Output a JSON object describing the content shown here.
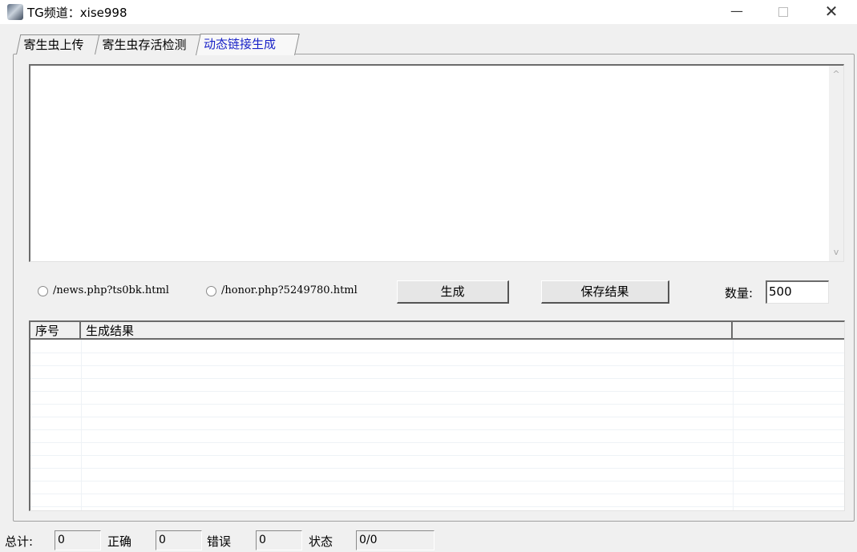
{
  "window": {
    "title": "TG频道：xise998",
    "minimize": "—",
    "close": "✕"
  },
  "tabs": [
    {
      "label": "寄生虫上传"
    },
    {
      "label": "寄生虫存活检测"
    },
    {
      "label": "动态链接生成"
    }
  ],
  "generator": {
    "textarea_value": "",
    "scroll_up": "^",
    "scroll_down": "v",
    "option1": "/news.php?ts0bk.html",
    "option2": "/honor.php?5249780.html",
    "generate_button": "生成",
    "save_button": "保存结果",
    "quantity_label": "数量:",
    "quantity_value": "500"
  },
  "results_table": {
    "columns": [
      "序号",
      "生成结果",
      ""
    ]
  },
  "status_bar": {
    "total_label": "总计:",
    "total_value": "0",
    "correct_label": "正确",
    "correct_value": "0",
    "error_label": "错误",
    "error_value": "0",
    "status_label": "状态",
    "status_value": "0/0"
  }
}
